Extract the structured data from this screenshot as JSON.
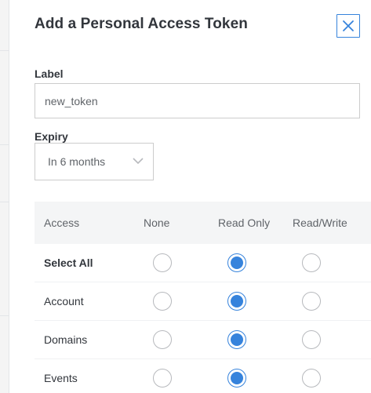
{
  "drawer": {
    "title": "Add a Personal Access Token"
  },
  "form": {
    "label_title": "Label",
    "label_value": "new_token",
    "expiry_title": "Expiry",
    "expiry_value": "In 6 months"
  },
  "access_table": {
    "headers": [
      "Access",
      "None",
      "Read Only",
      "Read/Write"
    ],
    "rows": [
      {
        "name": "Select All",
        "bold": true,
        "selected": "Read Only"
      },
      {
        "name": "Account",
        "bold": false,
        "selected": "Read Only"
      },
      {
        "name": "Domains",
        "bold": false,
        "selected": "Read Only"
      },
      {
        "name": "Events",
        "bold": false,
        "selected": "Read Only"
      }
    ]
  },
  "icons": {
    "close": "close-icon",
    "dropdown": "chevron-down-icon"
  },
  "colors": {
    "accent": "#3683dc",
    "header_bg": "#f4f5f6",
    "text": "#32363c"
  }
}
